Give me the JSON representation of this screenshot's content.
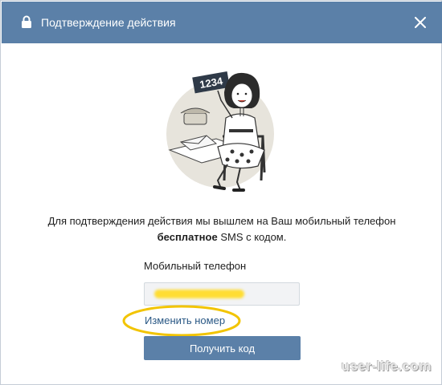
{
  "dialog": {
    "title": "Подтверждение действия",
    "message_part1": "Для подтверждения действия мы вышлем на Ваш мобильный телефон",
    "message_bold": "бесплатное",
    "message_part2": " SMS с кодом.",
    "phone_label": "Мобильный телефон",
    "phone_value_redacted": true,
    "change_number_link": "Изменить номер",
    "get_code_button": "Получить код"
  },
  "illustration": {
    "sign_text": "1234"
  },
  "watermark": "user-life.com",
  "colors": {
    "header": "#5b80a8",
    "button": "#5b80a8",
    "link": "#2a5885",
    "highlight_ellipse": "#f2c400",
    "redaction": "#ffdd33"
  }
}
